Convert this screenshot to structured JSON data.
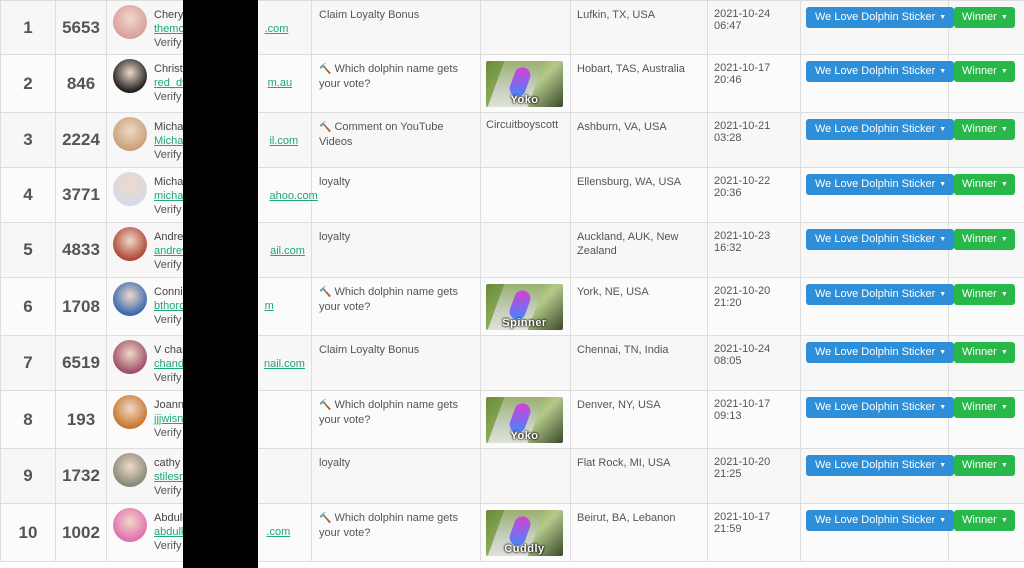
{
  "rows": [
    {
      "rank": "1",
      "points": "5653",
      "name": "Cheryl",
      "email": "themo",
      "email_end": ".com",
      "verify": "Verify a",
      "action_icon": "",
      "action": "Claim Loyalty Bonus",
      "media": "",
      "thumb_label": "",
      "location": "Lufkin, TX, USA",
      "date": "2021-10-24 06:47",
      "category": "We Love Dolphin Sticker",
      "status": "Winner",
      "avatar_color": "#d9a0a0"
    },
    {
      "rank": "2",
      "points": "846",
      "name": "Christo",
      "email": "red_dv",
      "email_end": "m.au",
      "verify": "Verify a",
      "action_icon": "wand-icon",
      "action": "Which dolphin name gets your vote?",
      "media": "thumb",
      "thumb_label": "Yoko",
      "location": "Hobart, TAS, Australia",
      "date": "2021-10-17 20:46",
      "category": "We Love Dolphin Sticker",
      "status": "Winner",
      "avatar_color": "#222222"
    },
    {
      "rank": "3",
      "points": "2224",
      "name": "Michae",
      "email": "Michae",
      "email_end": "il.com",
      "verify": "Verify a",
      "action_icon": "wand-icon",
      "action": "Comment on YouTube Videos",
      "media": "Circuitboyscott",
      "thumb_label": "",
      "location": "Ashburn, VA, USA",
      "date": "2021-10-21 03:28",
      "category": "We Love Dolphin Sticker",
      "status": "Winner",
      "avatar_color": "#c9a27a"
    },
    {
      "rank": "4",
      "points": "3771",
      "name": "Michae",
      "email": "michae",
      "email_end": "ahoo.com",
      "verify": "Verify a",
      "action_icon": "",
      "action": "loyalty",
      "media": "",
      "thumb_label": "",
      "location": "Ellensburg, WA, USA",
      "date": "2021-10-22 20:36",
      "category": "We Love Dolphin Sticker",
      "status": "Winner",
      "avatar_color": "#d7dbe6"
    },
    {
      "rank": "5",
      "points": "4833",
      "name": "Andrew",
      "email": "andrew",
      "email_end": "ail.com",
      "verify": "Verify a",
      "action_icon": "",
      "action": "loyalty",
      "media": "",
      "thumb_label": "",
      "location": "Auckland, AUK, New Zealand",
      "date": "2021-10-23 16:32",
      "category": "We Love Dolphin Sticker",
      "status": "Winner",
      "avatar_color": "#b04a3a"
    },
    {
      "rank": "6",
      "points": "1708",
      "name": "Connie",
      "email": "bthorc",
      "email_end": "m",
      "verify": "Verify a",
      "action_icon": "wand-icon",
      "action": "Which dolphin name gets your vote?",
      "media": "thumb",
      "thumb_label": "Spinner",
      "location": "York, NE, USA",
      "date": "2021-10-20 21:20",
      "category": "We Love Dolphin Sticker",
      "status": "Winner",
      "avatar_color": "#3a6ab0"
    },
    {
      "rank": "7",
      "points": "6519",
      "name": "V chan",
      "email": "chand",
      "email_end": "nail.com",
      "verify": "Verify a",
      "action_icon": "",
      "action": "Claim Loyalty Bonus",
      "media": "",
      "thumb_label": "",
      "location": "Chennai, TN, India",
      "date": "2021-10-24 08:05",
      "category": "We Love Dolphin Sticker",
      "status": "Winner",
      "avatar_color": "#a0506a"
    },
    {
      "rank": "8",
      "points": "193",
      "name": "Joanne",
      "email": "jjjwisn",
      "email_end": "",
      "verify": "Verify a",
      "action_icon": "wand-icon",
      "action": "Which dolphin name gets your vote?",
      "media": "thumb",
      "thumb_label": "Yoko",
      "location": "Denver, NY, USA",
      "date": "2021-10-17 09:13",
      "category": "We Love Dolphin Sticker",
      "status": "Winner",
      "avatar_color": "#c87830"
    },
    {
      "rank": "9",
      "points": "1732",
      "name": "cathy",
      "email": "stilesm",
      "email_end": "",
      "verify": "Verify a",
      "action_icon": "",
      "action": "loyalty",
      "media": "",
      "thumb_label": "",
      "location": "Flat Rock, MI, USA",
      "date": "2021-10-20 21:25",
      "category": "We Love Dolphin Sticker",
      "status": "Winner",
      "avatar_color": "#8a8a7a"
    },
    {
      "rank": "10",
      "points": "1002",
      "name": "Abdulk",
      "email": "abdulk",
      "email_end": ".com",
      "verify": "Verify a",
      "action_icon": "wand-icon",
      "action": "Which dolphin name gets your vote?",
      "media": "thumb",
      "thumb_label": "Cuddly",
      "location": "Beirut, BA, Lebanon",
      "date": "2021-10-17 21:59",
      "category": "We Love Dolphin Sticker",
      "status": "Winner",
      "avatar_color": "#e070b0"
    }
  ],
  "redaction": "redacted-block"
}
